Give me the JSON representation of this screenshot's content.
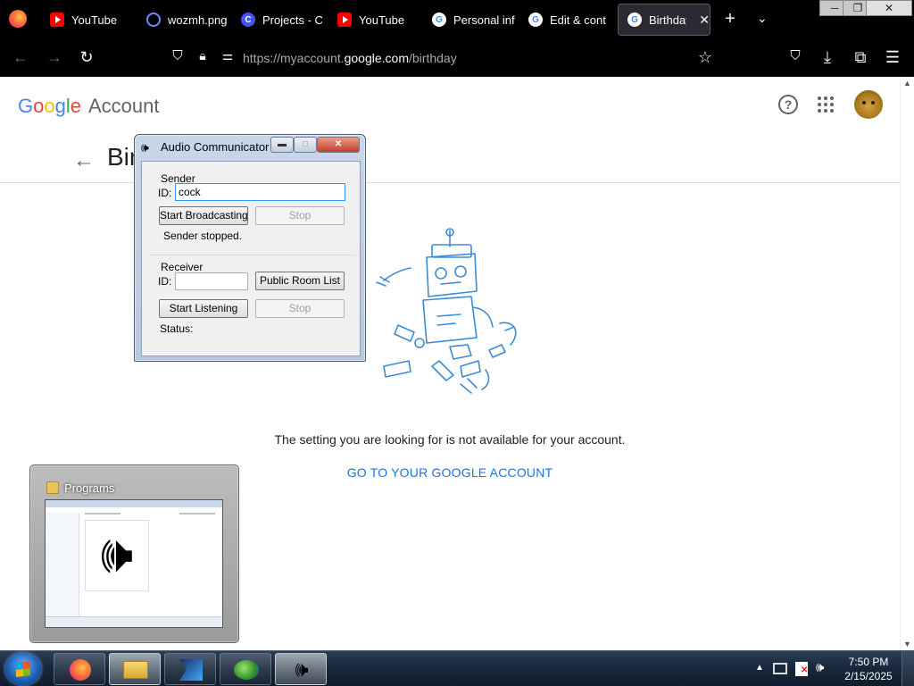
{
  "browser": {
    "tabs": [
      {
        "title": "YouTube",
        "favicon": "youtube-icon"
      },
      {
        "title": "wozmh.png",
        "favicon": "zoom-icon"
      },
      {
        "title": "Projects - C",
        "favicon": "canva-icon"
      },
      {
        "title": "YouTube",
        "favicon": "youtube-icon"
      },
      {
        "title": "Personal inf",
        "favicon": "google-icon"
      },
      {
        "title": "Edit & cont",
        "favicon": "google-icon"
      },
      {
        "title": "Birthday",
        "favicon": "google-icon",
        "active": true
      }
    ],
    "url_prefix": "https://myaccount.",
    "url_host": "google.com",
    "url_path": "/birthday"
  },
  "page": {
    "logo_text": "Google",
    "logo_suffix": "Account",
    "title_fragment": "Birt",
    "error_message": "The setting you are looking for is not available for your account.",
    "goto_link": "GO TO YOUR GOOGLE ACCOUNT"
  },
  "audio_communicator": {
    "window_title": "Audio Communicator",
    "sender": {
      "group_label": "Sender",
      "id_label": "ID:",
      "id_value": "cock",
      "start_button": "Start Broadcasting",
      "stop_button": "Stop",
      "status": "Sender stopped."
    },
    "receiver": {
      "group_label": "Receiver",
      "id_label": "ID:",
      "id_value": "",
      "room_list_button": "Public Room List",
      "start_button": "Start Listening",
      "stop_button": "Stop",
      "status_label": "Status:"
    }
  },
  "taskbar_preview": {
    "title": "Programs"
  },
  "taskbar": {
    "time": "7:50 PM",
    "date": "2/15/2025"
  },
  "colors": {
    "google_blue": "#4285F4",
    "google_red": "#EA4335",
    "google_yellow": "#FBBC05",
    "google_green": "#34A853",
    "link_blue": "#1a73e8",
    "robot_line": "#3d8bd6"
  }
}
